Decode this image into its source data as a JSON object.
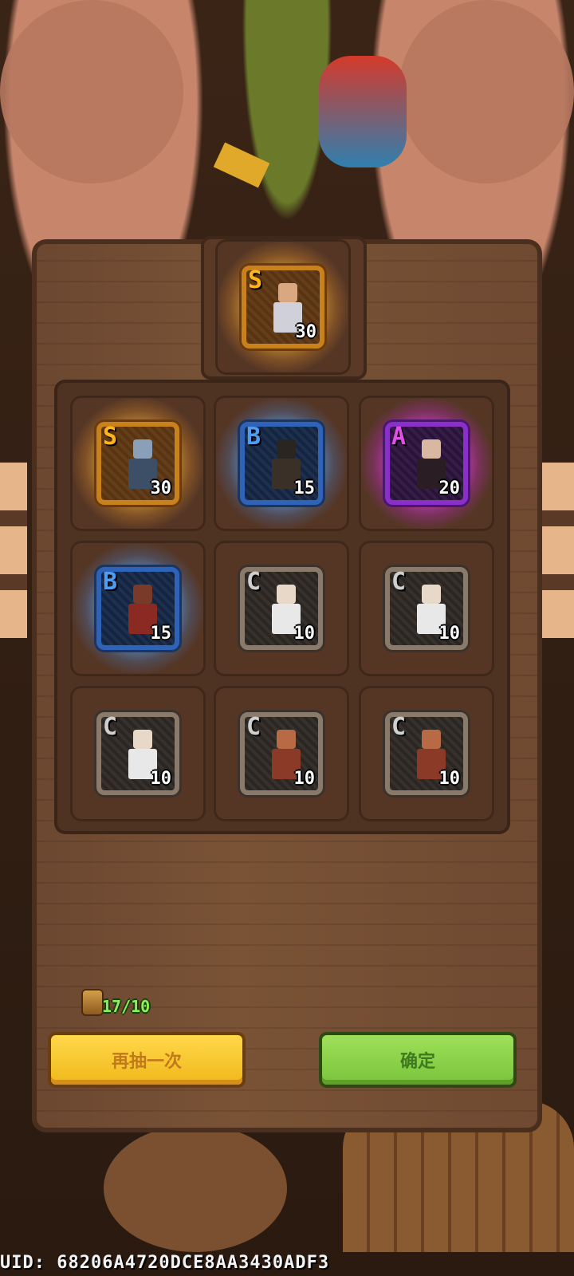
{
  "colors": {
    "rank_S": "#ffb41a",
    "rank_A": "#e050e8",
    "rank_B": "#4f9df0",
    "rank_C": "#cfcfcf",
    "redraw_button": "#ffd84a",
    "confirm_button": "#9fe05a"
  },
  "featured": {
    "rank": "S",
    "level": "30",
    "hero_icon": "hero-portrait-icon"
  },
  "results": [
    {
      "rank": "S",
      "level": "30"
    },
    {
      "rank": "B",
      "level": "15"
    },
    {
      "rank": "A",
      "level": "20"
    },
    {
      "rank": "B",
      "level": "15"
    },
    {
      "rank": "C",
      "level": "10"
    },
    {
      "rank": "C",
      "level": "10"
    },
    {
      "rank": "C",
      "level": "10"
    },
    {
      "rank": "C",
      "level": "10"
    },
    {
      "rank": "C",
      "level": "10"
    }
  ],
  "ticket": {
    "count": "17/10",
    "icon": "summon-ticket-icon"
  },
  "buttons": {
    "redraw": "再抽一次",
    "confirm": "确定"
  },
  "uid": "UID: 68206A4720DCE8AA3430ADF3"
}
